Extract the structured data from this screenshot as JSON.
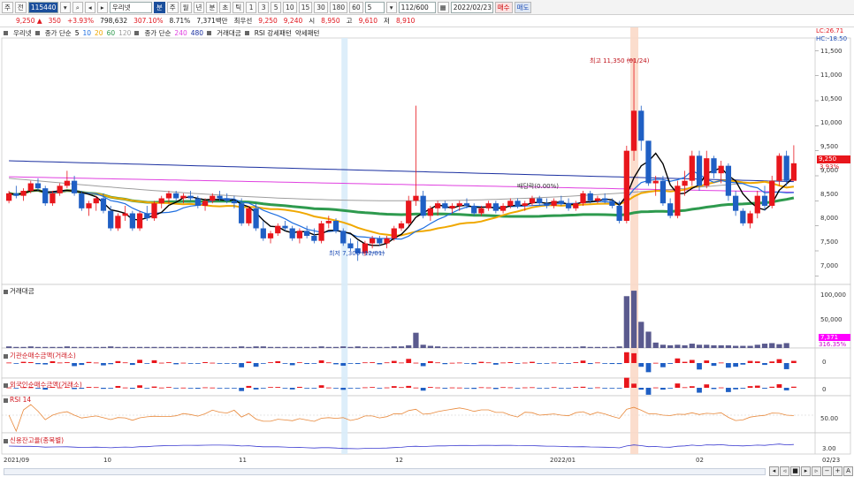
{
  "toolbar": {
    "items": [
      "주",
      "전"
    ],
    "code": "115440",
    "stock_name": "우리넷",
    "period_buttons": [
      "분",
      "주",
      "월",
      "년",
      "분",
      "초",
      "틱"
    ],
    "interval_buttons": [
      "1",
      "3",
      "5",
      "10",
      "15",
      "30",
      "180",
      "60"
    ],
    "count_box": "5",
    "page_count": "112/600",
    "date": "2022/02/23",
    "buy_label": "매수",
    "sell_label": "매도"
  },
  "infobar": {
    "price": "9,250",
    "change": "350",
    "change_pct": "+3.93%",
    "volume": "798,632",
    "vol_ratio": "307.10%",
    "turnover": "8.71%",
    "amount": "7,371백만",
    "pref": "최우선",
    "ask": "9,250",
    "bid": "9,240",
    "open_label": "시",
    "open": "8,950",
    "high_label": "고",
    "high": "9,610",
    "low_label": "저",
    "low": "8,910"
  },
  "legend": {
    "name": "우리넷",
    "ma_label": "종가 단순",
    "ma5": "5",
    "ma10": "10",
    "ma20": "20",
    "ma60": "60",
    "ma120": "120",
    "ma2_label": "종가 단순",
    "ma240": "240",
    "ma480": "480",
    "vol_label": "거래대금",
    "rsi_label": "RSI 강세패턴",
    "weak_label": "약세패턴"
  },
  "price_panel": {
    "lc": "LC:26.71",
    "hc": "HC:-18.50",
    "high_annot": "최고 11,350 (01/24)",
    "low_annot": "최저 7,300 (12/01)",
    "div_annot": "배당락(0.00%)",
    "current_price": "9,250",
    "current_pct": "3.93%",
    "axis": [
      "11,500",
      "11,000",
      "10,500",
      "10,000",
      "9,500",
      "9,000",
      "8,500",
      "8,000",
      "7,500",
      "7,000"
    ]
  },
  "volume_panel": {
    "title": "거래대금",
    "axis": [
      "100,000",
      "50,000"
    ],
    "current": "7,371",
    "current2": "316.35%"
  },
  "inst_panel": {
    "title": "기관순매수금액(거래소)",
    "axis": [
      "0"
    ]
  },
  "foreign_panel": {
    "title": "외국인순매수금액(거래소)",
    "axis": [
      "0"
    ]
  },
  "rsi_panel": {
    "title": "RSI 14",
    "axis": [
      "50.00"
    ]
  },
  "credit_panel": {
    "title": "신용잔고율(종목별)",
    "axis": [
      "3.00"
    ]
  },
  "xaxis": [
    "2021/09",
    "10",
    "11",
    "12",
    "2022/01",
    "02",
    "02/23"
  ],
  "colors": {
    "up": "#e8161c",
    "down": "#1f5fc4",
    "ma5": "#000000",
    "ma10": "#1f6fe0",
    "ma20": "#f0a800",
    "ma60": "#2e9a4e",
    "ma120": "#9e9e9e",
    "ma240": "#e040e0",
    "ma480": "#1a2fa0"
  },
  "candles": [
    [
      8500,
      8700,
      8450,
      8650
    ],
    [
      8650,
      8800,
      8550,
      8600
    ],
    [
      8600,
      8750,
      8500,
      8700
    ],
    [
      8700,
      8900,
      8650,
      8850
    ],
    [
      8850,
      8950,
      8700,
      8750
    ],
    [
      8750,
      8800,
      8400,
      8450
    ],
    [
      8450,
      8700,
      8400,
      8650
    ],
    [
      8650,
      8850,
      8600,
      8800
    ],
    [
      8800,
      9100,
      8750,
      8900
    ],
    [
      8900,
      9000,
      8600,
      8650
    ],
    [
      8650,
      8700,
      8300,
      8350
    ],
    [
      8350,
      8500,
      8200,
      8450
    ],
    [
      8450,
      8600,
      8300,
      8550
    ],
    [
      8550,
      8650,
      8250,
      8300
    ],
    [
      8300,
      8400,
      7900,
      7950
    ],
    [
      7950,
      8250,
      7900,
      8200
    ],
    [
      8200,
      8400,
      8100,
      8250
    ],
    [
      8250,
      8300,
      7900,
      7950
    ],
    [
      7950,
      8300,
      7900,
      8250
    ],
    [
      8250,
      8400,
      8100,
      8150
    ],
    [
      8150,
      8500,
      8100,
      8450
    ],
    [
      8450,
      8600,
      8350,
      8550
    ],
    [
      8550,
      8700,
      8450,
      8650
    ],
    [
      8650,
      8700,
      8500,
      8550
    ],
    [
      8550,
      8650,
      8450,
      8600
    ],
    [
      8600,
      8700,
      8500,
      8550
    ],
    [
      8550,
      8600,
      8350,
      8400
    ],
    [
      8400,
      8550,
      8300,
      8500
    ],
    [
      8500,
      8650,
      8450,
      8600
    ],
    [
      8600,
      8700,
      8500,
      8550
    ],
    [
      8550,
      8650,
      8450,
      8500
    ],
    [
      8500,
      8600,
      8350,
      8450
    ],
    [
      8450,
      8550,
      8000,
      8050
    ],
    [
      8050,
      8400,
      8000,
      8350
    ],
    [
      8350,
      8450,
      7900,
      7950
    ],
    [
      7950,
      8100,
      7700,
      7750
    ],
    [
      7750,
      7900,
      7650,
      7850
    ],
    [
      7850,
      8050,
      7800,
      8000
    ],
    [
      8000,
      8100,
      7900,
      7950
    ],
    [
      7950,
      8000,
      7700,
      7750
    ],
    [
      7750,
      7950,
      7650,
      7900
    ],
    [
      7900,
      8000,
      7750,
      7800
    ],
    [
      7800,
      7950,
      7650,
      7700
    ],
    [
      7700,
      8100,
      7650,
      8050
    ],
    [
      8050,
      8200,
      7950,
      8100
    ],
    [
      8100,
      8150,
      7850,
      7900
    ],
    [
      7900,
      7950,
      7600,
      7650
    ],
    [
      7650,
      7750,
      7500,
      7550
    ],
    [
      7550,
      7700,
      7300,
      7450
    ],
    [
      7450,
      7700,
      7400,
      7650
    ],
    [
      7650,
      7800,
      7550,
      7750
    ],
    [
      7750,
      7800,
      7600,
      7650
    ],
    [
      7650,
      7800,
      7550,
      7750
    ],
    [
      7750,
      8000,
      7700,
      7950
    ],
    [
      7950,
      8100,
      7900,
      8050
    ],
    [
      8050,
      8600,
      8000,
      8500
    ],
    [
      8500,
      10400,
      8400,
      8600
    ],
    [
      8600,
      8700,
      8150,
      8200
    ],
    [
      8200,
      8400,
      8100,
      8350
    ],
    [
      8350,
      8500,
      8200,
      8450
    ],
    [
      8450,
      8500,
      8300,
      8350
    ],
    [
      8350,
      8450,
      8250,
      8400
    ],
    [
      8400,
      8500,
      8300,
      8450
    ],
    [
      8450,
      8550,
      8350,
      8400
    ],
    [
      8400,
      8450,
      8200,
      8250
    ],
    [
      8250,
      8400,
      8200,
      8350
    ],
    [
      8350,
      8500,
      8300,
      8450
    ],
    [
      8450,
      8500,
      8250,
      8300
    ],
    [
      8300,
      8450,
      8250,
      8400
    ],
    [
      8400,
      8550,
      8350,
      8500
    ],
    [
      8500,
      8550,
      8350,
      8400
    ],
    [
      8400,
      8500,
      8300,
      8450
    ],
    [
      8450,
      8600,
      8400,
      8550
    ],
    [
      8550,
      8600,
      8400,
      8450
    ],
    [
      8450,
      8550,
      8350,
      8400
    ],
    [
      8400,
      8550,
      8350,
      8500
    ],
    [
      8500,
      8600,
      8400,
      8450
    ],
    [
      8450,
      8550,
      8300,
      8350
    ],
    [
      8350,
      8500,
      8300,
      8450
    ],
    [
      8450,
      8700,
      8400,
      8650
    ],
    [
      8650,
      8700,
      8450,
      8500
    ],
    [
      8500,
      8600,
      8450,
      8550
    ],
    [
      8550,
      8650,
      8450,
      8500
    ],
    [
      8500,
      8550,
      8350,
      8400
    ],
    [
      8400,
      8500,
      8050,
      8100
    ],
    [
      8100,
      9600,
      8050,
      9500
    ],
    [
      9500,
      11350,
      9300,
      10300
    ],
    [
      10300,
      10400,
      9500,
      9700
    ],
    [
      9700,
      9700,
      8800,
      8850
    ],
    [
      8850,
      9000,
      8600,
      8900
    ],
    [
      8900,
      9000,
      8400,
      8450
    ],
    [
      8450,
      8550,
      8150,
      8200
    ],
    [
      8200,
      8900,
      8150,
      8800
    ],
    [
      8800,
      9100,
      8600,
      8900
    ],
    [
      8900,
      9500,
      8800,
      9400
    ],
    [
      9400,
      9500,
      8700,
      8800
    ],
    [
      8800,
      9500,
      8750,
      9350
    ],
    [
      9350,
      9400,
      8950,
      9050
    ],
    [
      9050,
      9300,
      8850,
      9200
    ],
    [
      9200,
      9250,
      8500,
      8600
    ],
    [
      8600,
      8700,
      8200,
      8300
    ],
    [
      8300,
      8350,
      8000,
      8050
    ],
    [
      8050,
      8300,
      7950,
      8250
    ],
    [
      8250,
      8700,
      8150,
      8600
    ],
    [
      8600,
      8800,
      8300,
      8400
    ],
    [
      8400,
      9000,
      8350,
      8900
    ],
    [
      8900,
      9450,
      8800,
      9400
    ],
    [
      9400,
      9500,
      8800,
      8900
    ],
    [
      8900,
      9610,
      8910,
      9250
    ]
  ],
  "volumes": [
    3,
    2,
    2,
    3,
    2,
    2,
    2,
    2,
    3,
    2,
    2,
    2,
    2,
    2,
    3,
    2,
    2,
    2,
    2,
    2,
    2,
    2,
    2,
    2,
    2,
    2,
    2,
    2,
    2,
    2,
    2,
    2,
    3,
    2,
    3,
    3,
    2,
    2,
    2,
    2,
    2,
    2,
    2,
    3,
    2,
    2,
    3,
    2,
    3,
    2,
    2,
    2,
    2,
    3,
    3,
    5,
    28,
    6,
    4,
    3,
    2,
    2,
    2,
    2,
    2,
    2,
    2,
    2,
    2,
    2,
    2,
    2,
    2,
    2,
    2,
    2,
    2,
    2,
    2,
    3,
    2,
    2,
    2,
    2,
    3,
    95,
    105,
    48,
    30,
    10,
    6,
    5,
    6,
    5,
    8,
    6,
    6,
    5,
    5,
    5,
    4,
    4,
    4,
    6,
    8,
    9,
    7,
    9
  ]
}
